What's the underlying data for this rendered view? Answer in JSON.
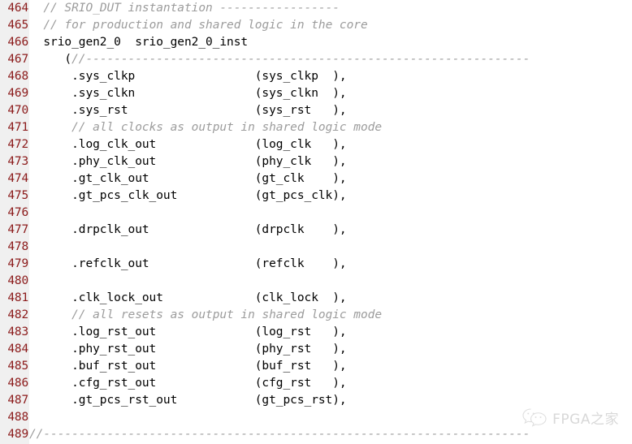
{
  "editor": {
    "language": "verilog",
    "first_line": 464,
    "last_line": 489,
    "colors": {
      "gutter_background": "#f0f0f0",
      "line_number": "#8b1a1a",
      "code_text": "#000000",
      "comment_text": "#9c9c9c",
      "page_background": "#ffffff"
    }
  },
  "watermark": {
    "text": "FPGA之家",
    "logo_name": "wechat-logo",
    "color": "#b9b9b9"
  },
  "lines": [
    {
      "number": "464",
      "segments": [
        {
          "kind": "plain",
          "text": "  "
        },
        {
          "kind": "comment",
          "text": "// SRIO_DUT instantation -----------------"
        }
      ]
    },
    {
      "number": "465",
      "segments": [
        {
          "kind": "plain",
          "text": "  "
        },
        {
          "kind": "comment",
          "text": "// for production and shared logic in the core"
        }
      ]
    },
    {
      "number": "466",
      "segments": [
        {
          "kind": "plain",
          "text": "  srio_gen2_0  srio_gen2_0_inst"
        }
      ]
    },
    {
      "number": "467",
      "segments": [
        {
          "kind": "plain",
          "text": "     ("
        },
        {
          "kind": "comment",
          "text": "//---------------------------------------------------------------"
        }
      ]
    },
    {
      "number": "468",
      "segments": [
        {
          "kind": "plain",
          "text": "      .sys_clkp                 (sys_clkp  ),"
        }
      ]
    },
    {
      "number": "469",
      "segments": [
        {
          "kind": "plain",
          "text": "      .sys_clkn                 (sys_clkn  ),"
        }
      ]
    },
    {
      "number": "470",
      "segments": [
        {
          "kind": "plain",
          "text": "      .sys_rst                  (sys_rst   ),"
        }
      ]
    },
    {
      "number": "471",
      "segments": [
        {
          "kind": "plain",
          "text": "      "
        },
        {
          "kind": "comment",
          "text": "// all clocks as output in shared logic mode"
        }
      ]
    },
    {
      "number": "472",
      "segments": [
        {
          "kind": "plain",
          "text": "      .log_clk_out              (log_clk   ),"
        }
      ]
    },
    {
      "number": "473",
      "segments": [
        {
          "kind": "plain",
          "text": "      .phy_clk_out              (phy_clk   ),"
        }
      ]
    },
    {
      "number": "474",
      "segments": [
        {
          "kind": "plain",
          "text": "      .gt_clk_out               (gt_clk    ),"
        }
      ]
    },
    {
      "number": "475",
      "segments": [
        {
          "kind": "plain",
          "text": "      .gt_pcs_clk_out           (gt_pcs_clk),"
        }
      ]
    },
    {
      "number": "476",
      "segments": [
        {
          "kind": "plain",
          "text": ""
        }
      ]
    },
    {
      "number": "477",
      "segments": [
        {
          "kind": "plain",
          "text": "      .drpclk_out               (drpclk    ),"
        }
      ]
    },
    {
      "number": "478",
      "segments": [
        {
          "kind": "plain",
          "text": ""
        }
      ]
    },
    {
      "number": "479",
      "segments": [
        {
          "kind": "plain",
          "text": "      .refclk_out               (refclk    ),"
        }
      ]
    },
    {
      "number": "480",
      "segments": [
        {
          "kind": "plain",
          "text": ""
        }
      ]
    },
    {
      "number": "481",
      "segments": [
        {
          "kind": "plain",
          "text": "      .clk_lock_out             (clk_lock  ),"
        }
      ]
    },
    {
      "number": "482",
      "segments": [
        {
          "kind": "plain",
          "text": "      "
        },
        {
          "kind": "comment",
          "text": "// all resets as output in shared logic mode"
        }
      ]
    },
    {
      "number": "483",
      "segments": [
        {
          "kind": "plain",
          "text": "      .log_rst_out              (log_rst   ),"
        }
      ]
    },
    {
      "number": "484",
      "segments": [
        {
          "kind": "plain",
          "text": "      .phy_rst_out              (phy_rst   ),"
        }
      ]
    },
    {
      "number": "485",
      "segments": [
        {
          "kind": "plain",
          "text": "      .buf_rst_out              (buf_rst   ),"
        }
      ]
    },
    {
      "number": "486",
      "segments": [
        {
          "kind": "plain",
          "text": "      .cfg_rst_out              (cfg_rst   ),"
        }
      ]
    },
    {
      "number": "487",
      "segments": [
        {
          "kind": "plain",
          "text": "      .gt_pcs_rst_out           (gt_pcs_rst),"
        }
      ]
    },
    {
      "number": "488",
      "segments": [
        {
          "kind": "plain",
          "text": ""
        }
      ]
    },
    {
      "number": "489",
      "segments": [
        {
          "kind": "comment",
          "text": "//---------------------------------------------------------------------"
        }
      ]
    }
  ]
}
